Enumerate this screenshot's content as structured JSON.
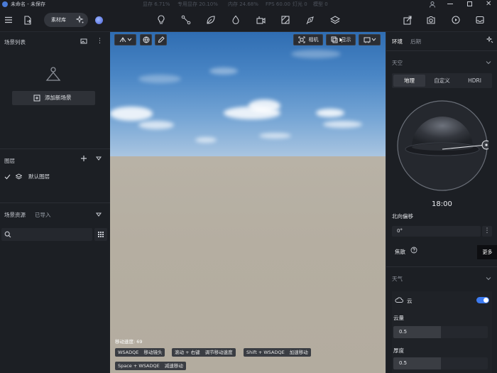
{
  "titlebar": {
    "title": "未命名 - 未保存",
    "stats": [
      "显存 6.71%",
      "专用显存 20.10%",
      "内存 24.68%",
      "FPS 60.00",
      "灯光 0",
      "模型 0"
    ]
  },
  "toolbar": {
    "material_label": "素材库"
  },
  "left": {
    "scene_list_title": "场景列表",
    "add_scene_label": "添加新场景",
    "layers_title": "图层",
    "default_layer_label": "默认图层",
    "assets_title": "场景资源",
    "imported_label": "已导入"
  },
  "viewport": {
    "camera_label": "相机",
    "display_label": "显示",
    "speed_label": "移动速度: 69",
    "shortcuts": [
      {
        "key": "WSADQE",
        "desc": "移动镜头"
      },
      {
        "key": "滚动 + 右键",
        "desc": "调节移动速度"
      },
      {
        "key": "Shift + WSADQE",
        "desc": "加速移动"
      },
      {
        "key": "Space + WSADQE",
        "desc": "减速移动"
      }
    ]
  },
  "right": {
    "tabs": [
      "环境",
      "后期"
    ],
    "sky_title": "天空",
    "sky_modes": [
      "地理",
      "自定义",
      "HDRI"
    ],
    "time": "18:00",
    "north_offset_label": "北向偏移",
    "north_offset_value": "0°",
    "focus_label": "焦散",
    "more_tooltip": "更多",
    "weather_title": "天气",
    "cloud_label": "云",
    "cloud_amount_label": "云量",
    "cloud_amount_value": "0.5",
    "thickness_label": "厚度",
    "thickness_value": "0.5",
    "cloud_enabled": true
  }
}
